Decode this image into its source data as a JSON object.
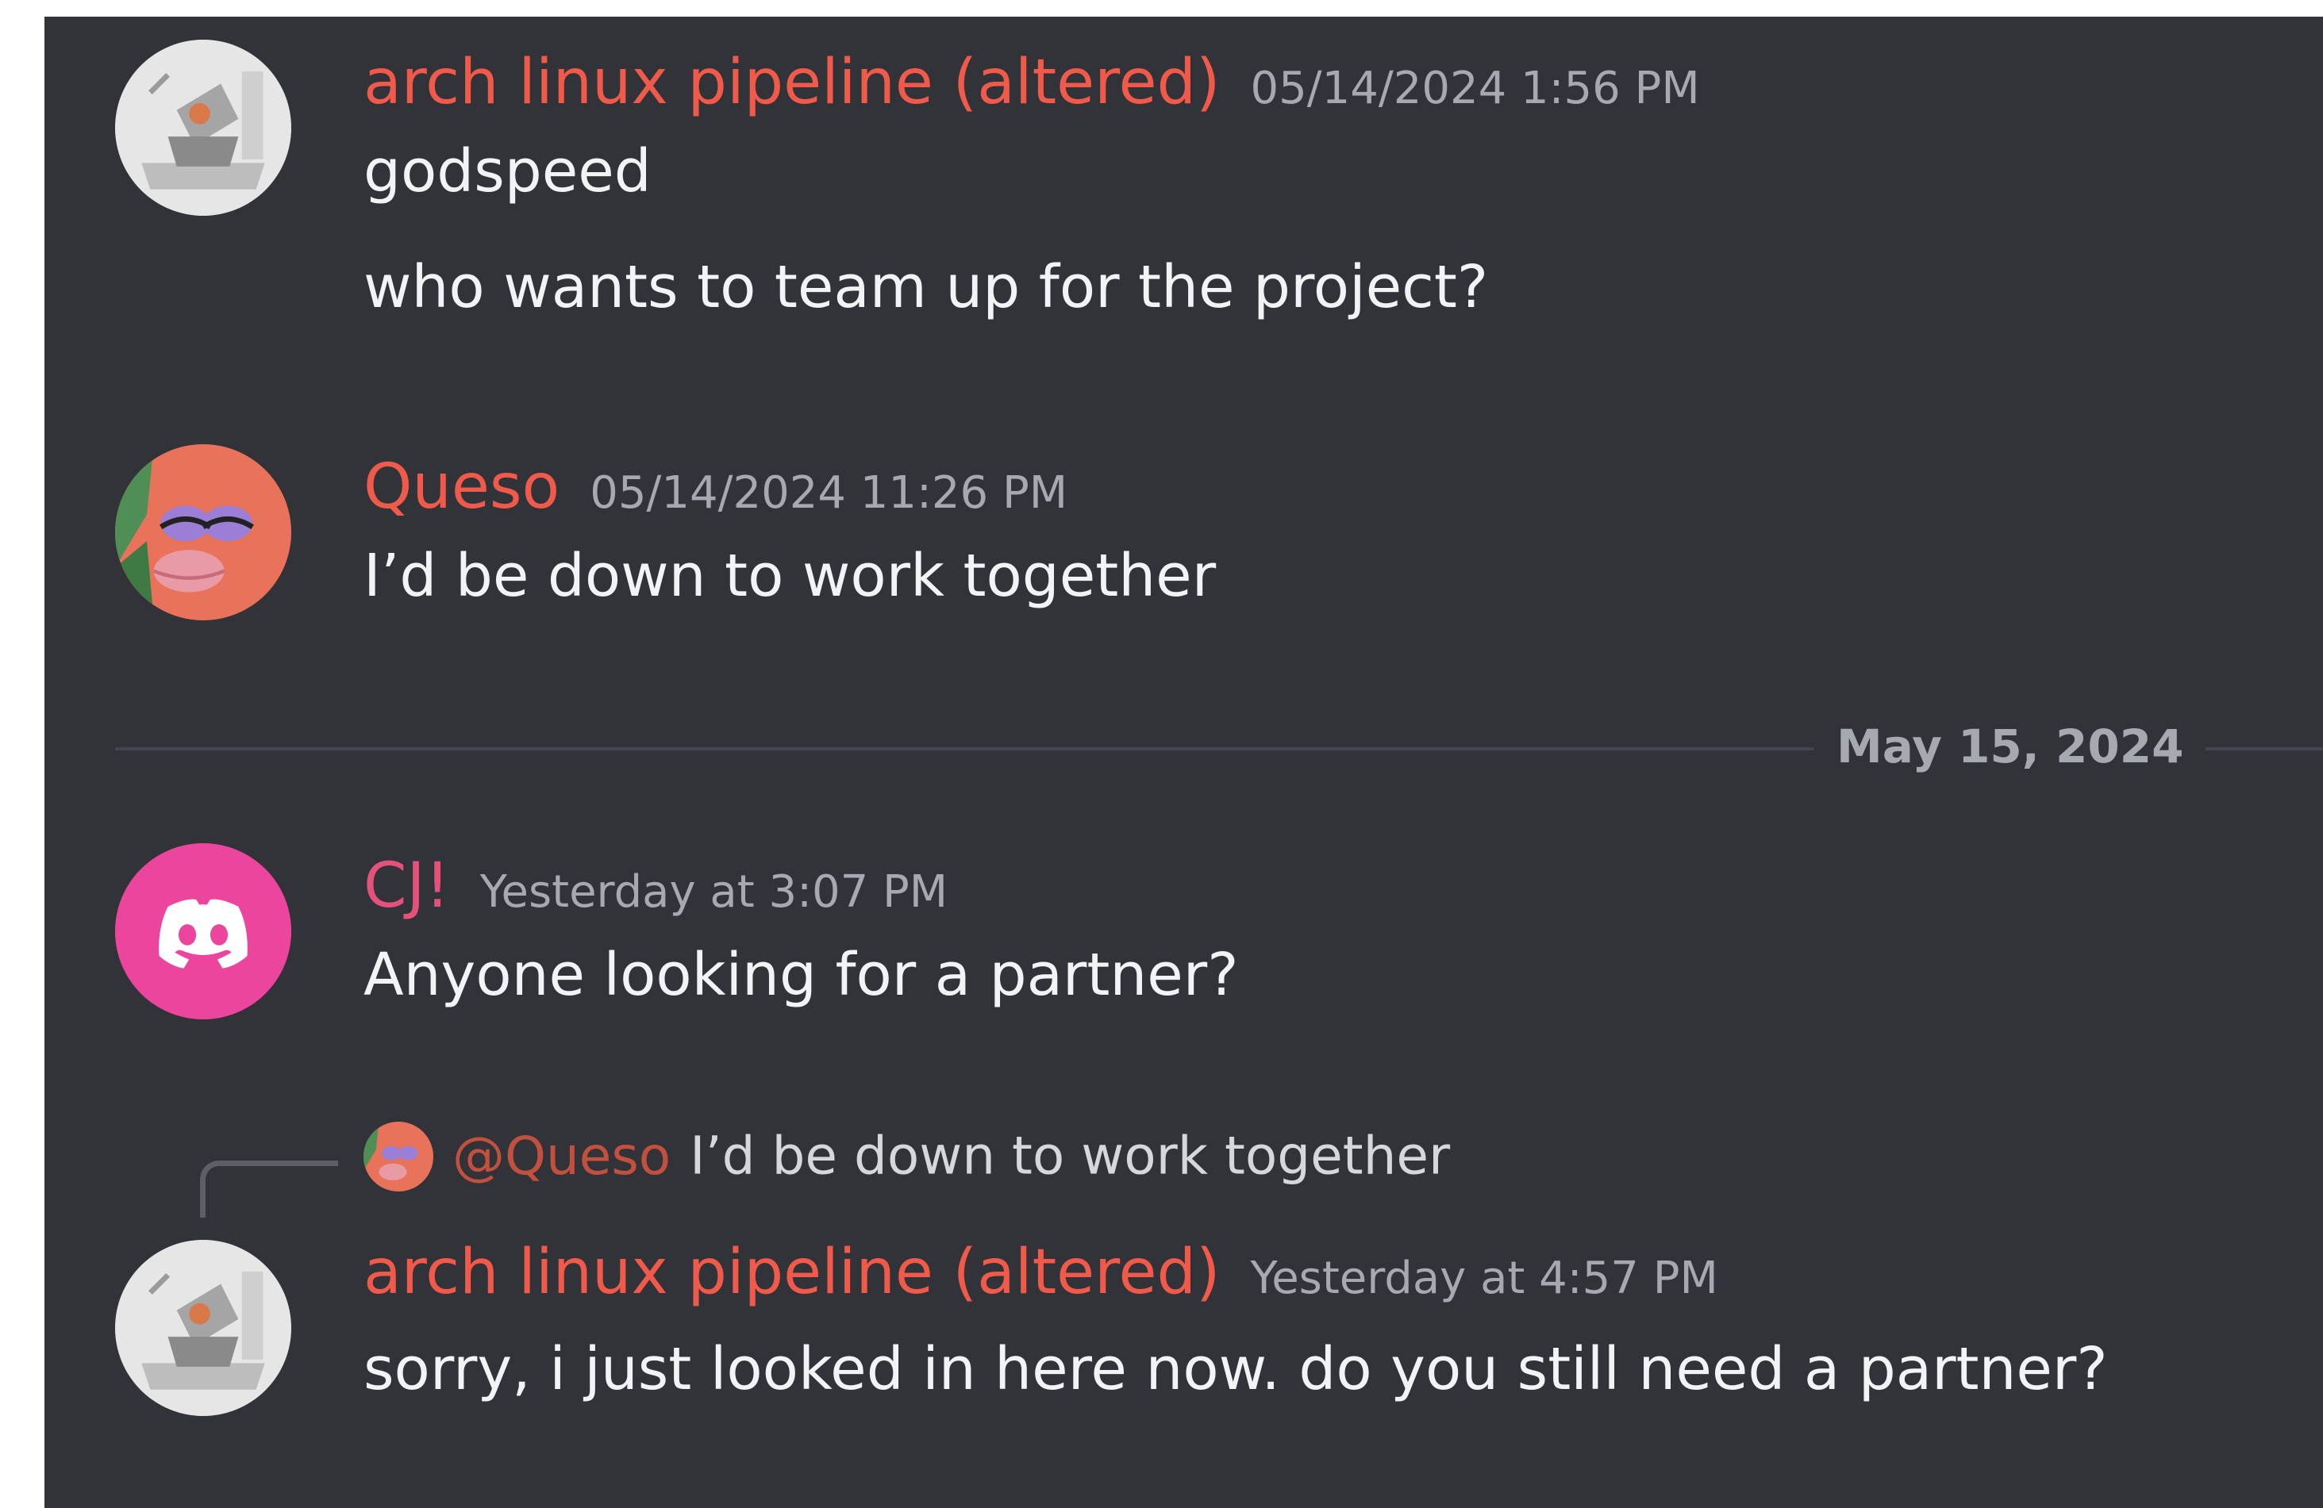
{
  "messages": [
    {
      "username": "arch linux pipeline (altered)",
      "timestamp": "05/14/2024 1:56 PM",
      "lines": [
        "godspeed",
        "who wants to team up for the project?"
      ]
    },
    {
      "username": "Queso",
      "timestamp": "05/14/2024 11:26 PM",
      "lines": [
        "I’d be down to work together"
      ]
    },
    {
      "username": "CJ!",
      "timestamp": "Yesterday at 3:07 PM",
      "lines": [
        "Anyone looking for a partner?"
      ]
    },
    {
      "reply": {
        "mention": "@Queso",
        "text": "I’d be down to work together"
      },
      "username": "arch linux pipeline (altered)",
      "timestamp": "Yesterday at 4:57 PM",
      "lines": [
        "sorry, i just looked in here now. do you still need a partner?"
      ]
    }
  ],
  "date_divider": "May 15, 2024",
  "colors": {
    "background": "#313338",
    "username_orange": "#ef5a4a",
    "username_pink": "#e4527a",
    "discord_avatar": "#eb459e",
    "timestamp": "#a6a9b0",
    "text": "#f2f3f5"
  },
  "icons": {
    "arch_avatar": "sketch-avatar-icon",
    "queso_avatar": "patrick-star-avatar-icon",
    "cj_avatar": "discord-logo-icon"
  }
}
